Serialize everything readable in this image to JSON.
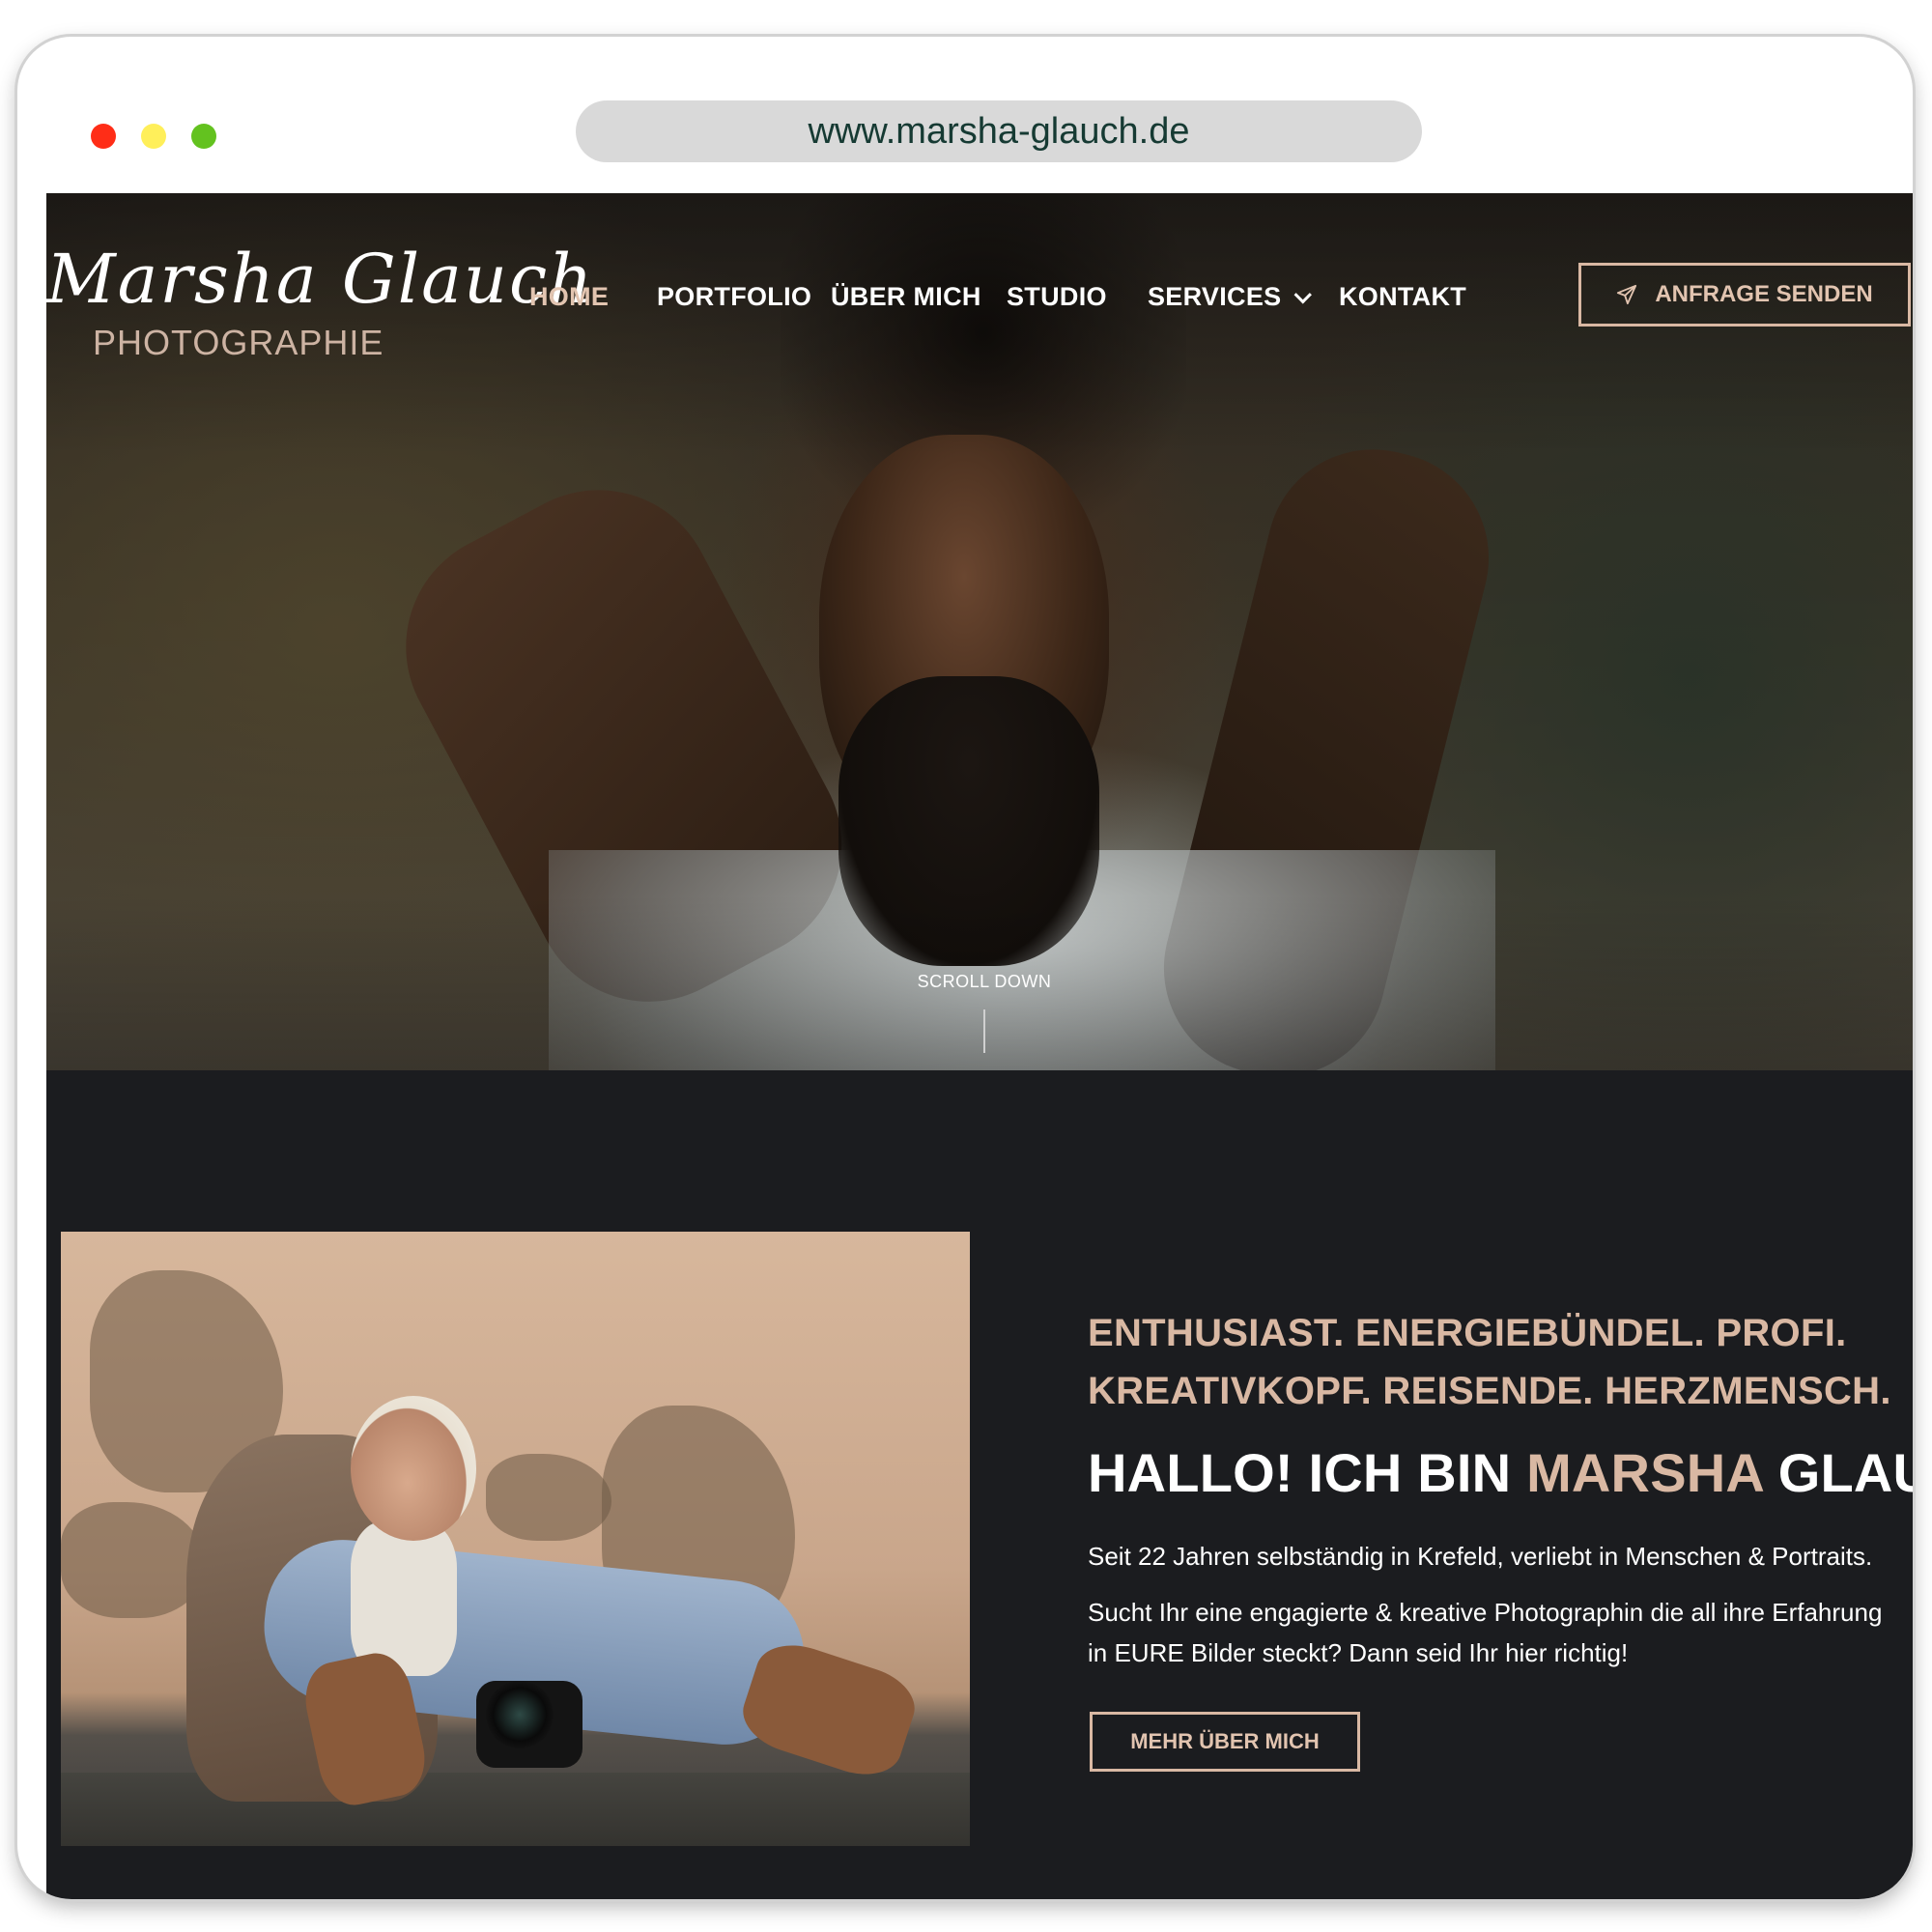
{
  "browser": {
    "url": "www.marsha-glauch.de",
    "controls": [
      "close",
      "minimize",
      "maximize"
    ]
  },
  "logo": {
    "script_name": "Marsha Glauch",
    "subtitle": "PHOTOGRAPHIE"
  },
  "nav": {
    "items": [
      {
        "label": "HOME",
        "active": true
      },
      {
        "label": "PORTFOLIO",
        "active": false
      },
      {
        "label": "ÜBER MICH",
        "active": false
      },
      {
        "label": "STUDIO",
        "active": false
      },
      {
        "label": "SERVICES",
        "active": false,
        "has_dropdown": true
      },
      {
        "label": "KONTAKT",
        "active": false
      }
    ],
    "cta_label": "ANFRAGE SENDEN",
    "cta_icon": "paper-plane-icon"
  },
  "hero": {
    "scroll_label": "SCROLL DOWN"
  },
  "about": {
    "tagline_line1": "ENTHUSIAST. ENERGIEBÜNDEL. PROFI.",
    "tagline_line2": "KREATIVKOPF. REISENDE. HERZMENSCH.",
    "headline_prefix": "HALLO! ICH BIN ",
    "headline_accent": "MARSHA",
    "headline_suffix": " GLAUCH.",
    "paragraph1": "Seit 22 Jahren selbständig in Krefeld, verliebt in Menschen & Portraits.",
    "paragraph2": "Sucht Ihr eine engagierte & kreative Photographin die all ihre Erfahrung in EURE Bilder steckt? Dann seid Ihr hier richtig!",
    "button_label": "MEHR ÜBER MICH"
  },
  "colors": {
    "accent": "#d9b8a3",
    "background": "#1b1c1f",
    "nav_text": "#ffffff"
  }
}
